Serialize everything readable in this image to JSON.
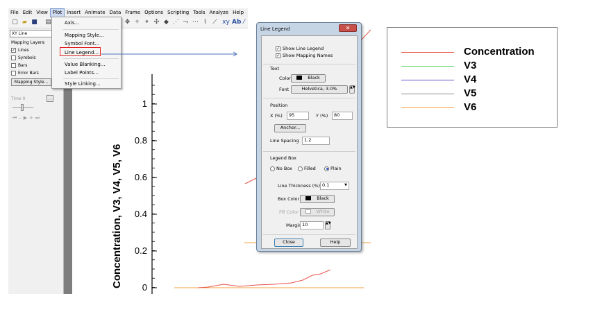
{
  "menubar": [
    "File",
    "Edit",
    "View",
    "Plot",
    "Insert",
    "Animate",
    "Data",
    "Frame",
    "Options",
    "Scripting",
    "Tools",
    "Analyze",
    "Help"
  ],
  "sidebar": {
    "plot_type": "XY Line",
    "mapping_layers_label": "Mapping Layers:",
    "layers": [
      {
        "label": "Lines",
        "checked": true
      },
      {
        "label": "Symbols",
        "checked": false
      },
      {
        "label": "Bars",
        "checked": false
      },
      {
        "label": "Error Bars",
        "checked": false
      }
    ],
    "mapping_style_button": "Mapping Style...",
    "time_label": "Time",
    "time_value": "0"
  },
  "plot_menu": {
    "items": [
      "Axis...",
      "Mapping Style...",
      "Symbol Font...",
      "Line Legend...",
      "Value Blanking...",
      "Label Points...",
      "Style Linking..."
    ]
  },
  "axis": {
    "label": "Concentration, V3, V4, V5, V6",
    "ticks": [
      "1",
      "0.8",
      "0.6",
      "0.4",
      "0.2",
      "0"
    ]
  },
  "dialog": {
    "title": "Line Legend",
    "show_line_legend": "Show Line Legend",
    "show_mapping_names": "Show Mapping Names",
    "text_section": "Text",
    "color_label": "Color",
    "color_value": "Black",
    "font_label": "Font",
    "font_value": "Helvetica, 3.0%",
    "position_section": "Position",
    "x_label": "X (%)",
    "x_value": "95",
    "y_label": "Y (%)",
    "y_value": "80",
    "anchor_button": "Anchor...",
    "line_spacing_label": "Line Spacing",
    "line_spacing_value": "1.2",
    "legend_box_section": "Legend Box",
    "box_options": [
      "No Box",
      "Filled",
      "Plain"
    ],
    "line_thickness_label": "Line Thickness (%)",
    "line_thickness_value": "0.1",
    "box_color_label": "Box Color",
    "box_color_value": "Black",
    "fill_color_label": "Fill Color",
    "fill_color_value": "White",
    "margin_label": "Margin",
    "margin_value": "10",
    "close_button": "Close",
    "help_button": "Help"
  },
  "legend": {
    "entries": [
      {
        "label": "Concentration",
        "color": "#e8534a"
      },
      {
        "label": "V3",
        "color": "#4fcf5c"
      },
      {
        "label": "V4",
        "color": "#5a4fd0"
      },
      {
        "label": "V5",
        "color": "#8a8a8a"
      },
      {
        "label": "V6",
        "color": "#f0a040"
      }
    ]
  }
}
